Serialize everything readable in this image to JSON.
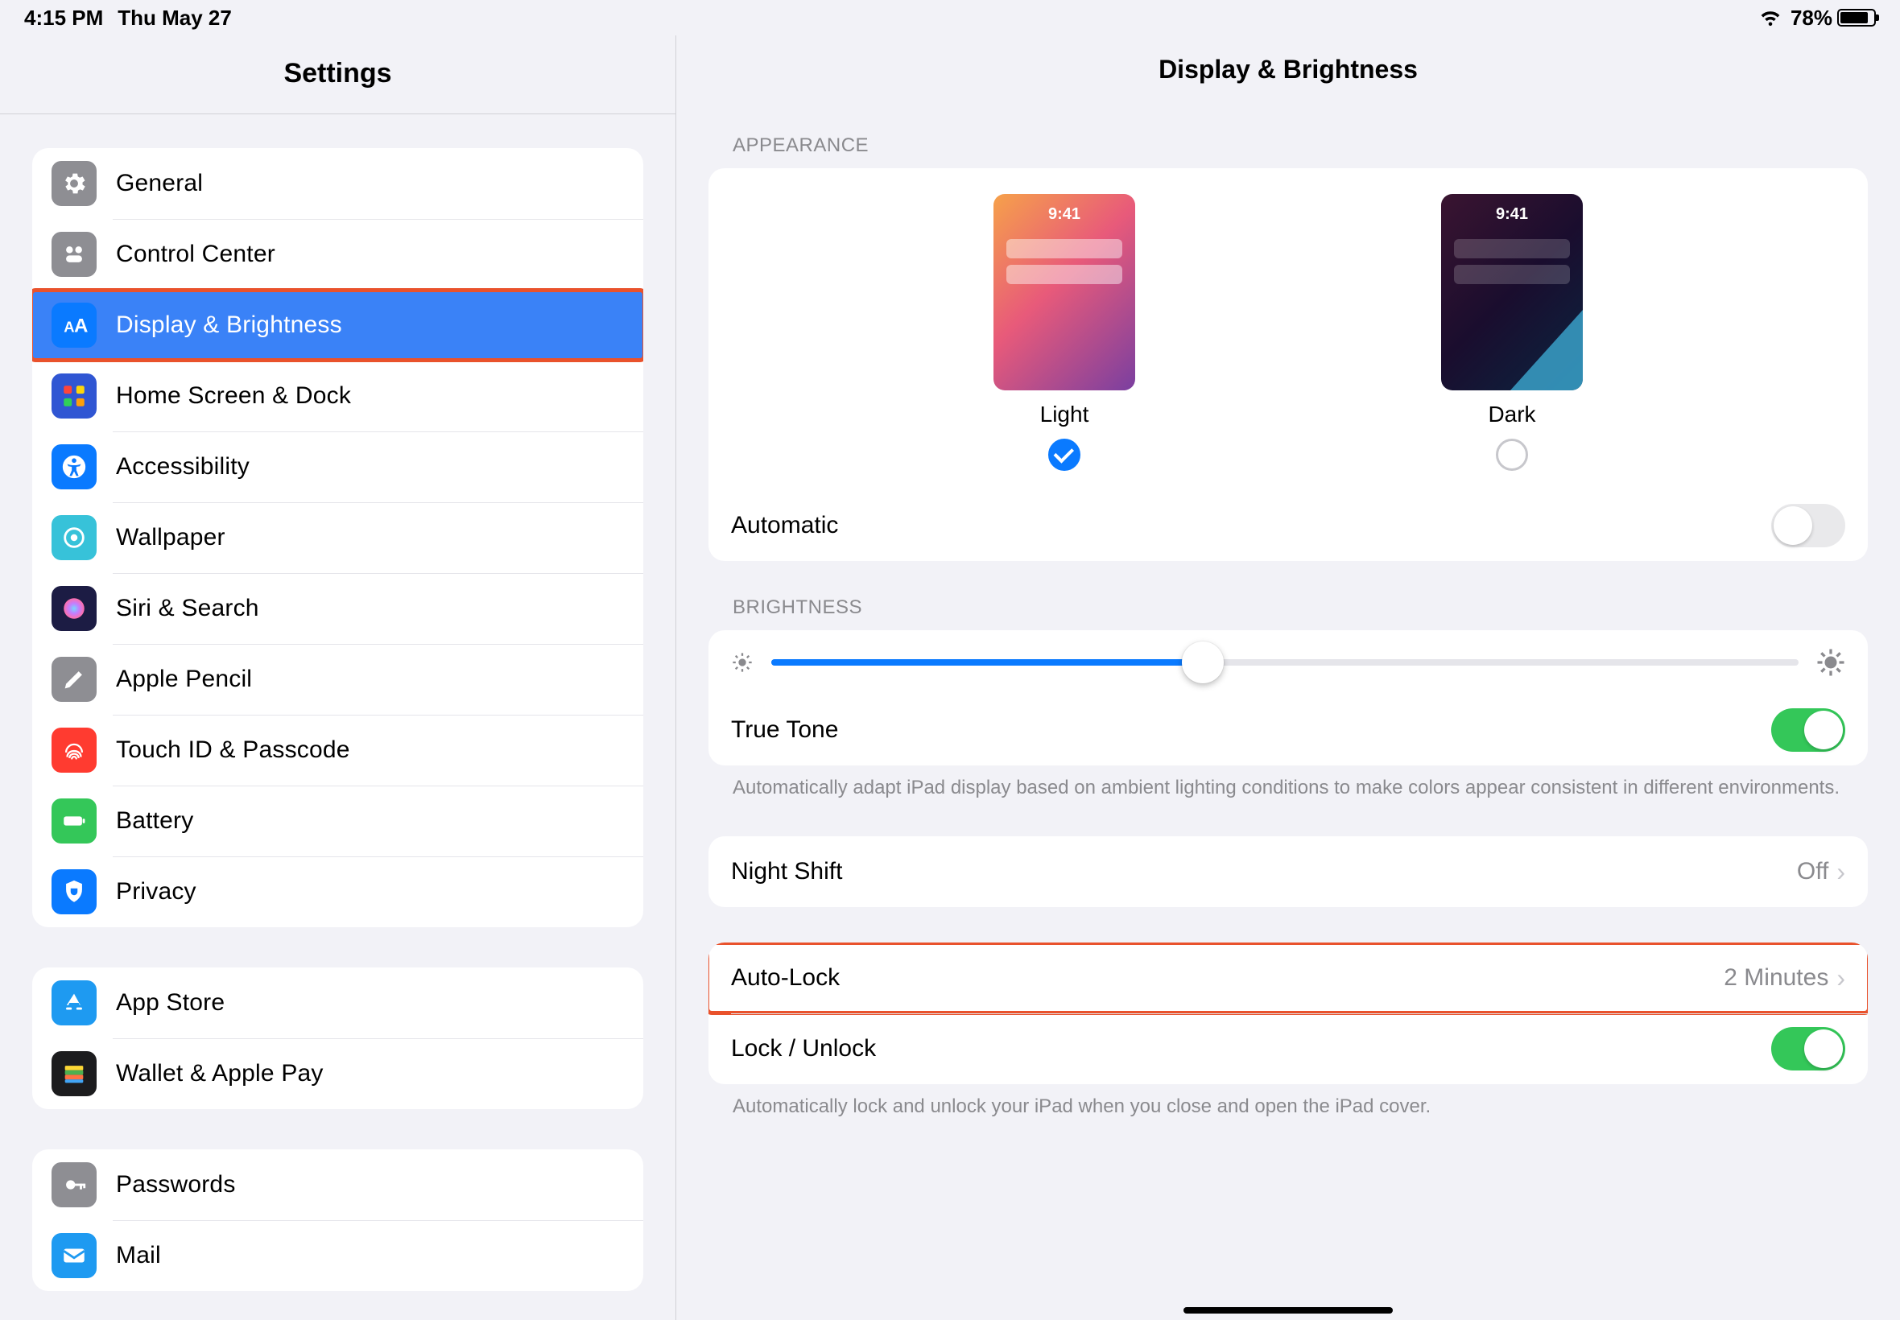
{
  "status": {
    "time": "4:15 PM",
    "date": "Thu May 27",
    "battery_pct": "78%"
  },
  "sidebar": {
    "title": "Settings",
    "groups": [
      [
        {
          "key": "general",
          "label": "General"
        },
        {
          "key": "cc",
          "label": "Control Center"
        },
        {
          "key": "display",
          "label": "Display & Brightness",
          "selected": true,
          "highlighted": true
        },
        {
          "key": "home",
          "label": "Home Screen & Dock"
        },
        {
          "key": "access",
          "label": "Accessibility"
        },
        {
          "key": "wallpaper",
          "label": "Wallpaper"
        },
        {
          "key": "siri",
          "label": "Siri & Search"
        },
        {
          "key": "pencil",
          "label": "Apple Pencil"
        },
        {
          "key": "touchid",
          "label": "Touch ID & Passcode"
        },
        {
          "key": "battery",
          "label": "Battery"
        },
        {
          "key": "privacy",
          "label": "Privacy"
        }
      ],
      [
        {
          "key": "appstore",
          "label": "App Store"
        },
        {
          "key": "wallet",
          "label": "Wallet & Apple Pay"
        }
      ],
      [
        {
          "key": "passwords",
          "label": "Passwords"
        },
        {
          "key": "mail",
          "label": "Mail"
        }
      ]
    ]
  },
  "detail": {
    "title": "Display & Brightness",
    "appearance": {
      "section_label": "APPEARANCE",
      "preview_time": "9:41",
      "light": "Light",
      "dark": "Dark",
      "selected": "light",
      "automatic_label": "Automatic",
      "automatic_on": false
    },
    "brightness": {
      "section_label": "BRIGHTNESS",
      "value_pct": 42,
      "truetone_label": "True Tone",
      "truetone_on": true,
      "truetone_footer": "Automatically adapt iPad display based on ambient lighting conditions to make colors appear consistent in different environments."
    },
    "nightshift": {
      "label": "Night Shift",
      "value": "Off"
    },
    "autolock": {
      "label": "Auto-Lock",
      "value": "2 Minutes",
      "highlighted": true
    },
    "lockunlock": {
      "label": "Lock / Unlock",
      "on": true,
      "footer": "Automatically lock and unlock your iPad when you close and open the iPad cover."
    }
  }
}
